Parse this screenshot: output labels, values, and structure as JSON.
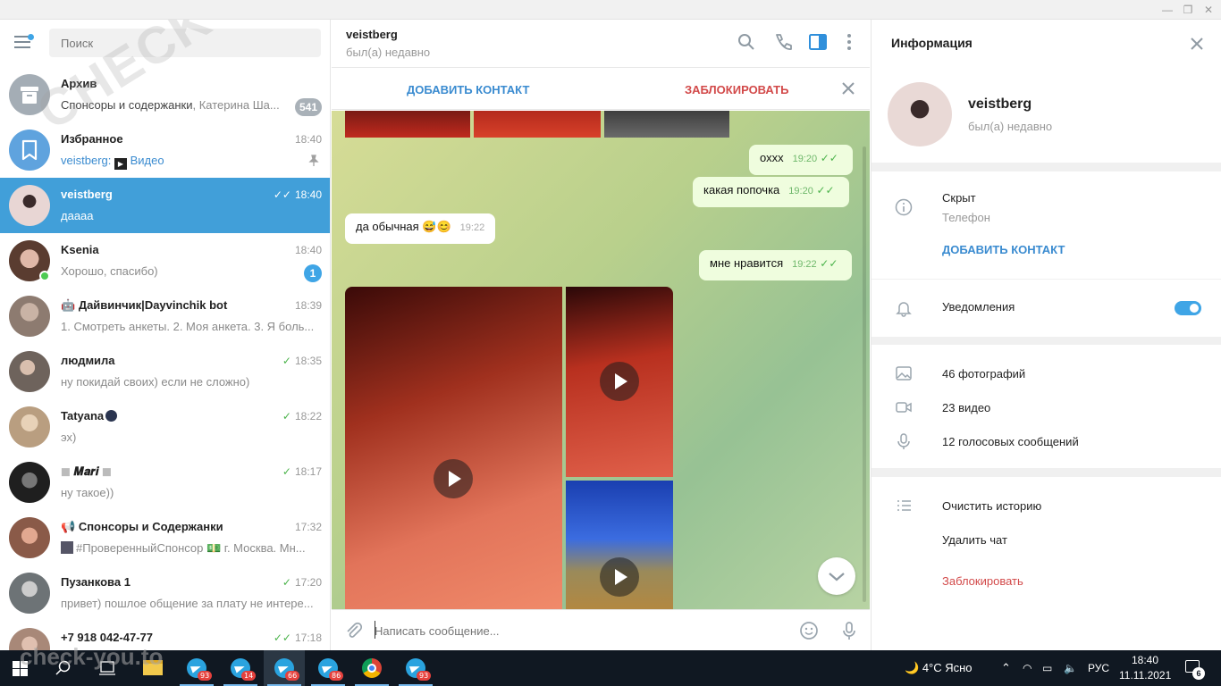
{
  "window": {
    "minimize": "—",
    "maximize": "❐",
    "close": "✕"
  },
  "sidebar": {
    "search_placeholder": "Поиск",
    "chats": [
      {
        "name": "Архив",
        "message": "Спонсоры и содержанки",
        "message_suffix": ", Катерина Ша...",
        "time": "",
        "badge": "541",
        "avatar_color": "#a4adb5"
      },
      {
        "name": "Избранное",
        "message": "veistberg:",
        "message_suffix": "Видео",
        "time": "18:40",
        "badge": "",
        "avatar_color": "#5fa3de"
      },
      {
        "name": "veistberg",
        "message": "даааа",
        "message_suffix": "",
        "time": "18:40",
        "badge": "",
        "avatar_color": "#d8b9b5"
      },
      {
        "name": "Ksenia",
        "message": "Хорошо, спасибо)",
        "message_suffix": "",
        "time": "18:40",
        "badge": "1",
        "avatar_color": "#6b4b3c"
      },
      {
        "name": "Дайвинчик|Dayvinchik bot",
        "message": "1. Смотреть анкеты. 2. Моя анкета. 3. Я боль...",
        "message_suffix": "",
        "time": "18:39",
        "badge": "",
        "avatar_color": "#9a8a80"
      },
      {
        "name": "людмила",
        "message": "ну покидай своих) если не сложно)",
        "message_suffix": "",
        "time": "18:35",
        "badge": "",
        "avatar_color": "#7d6f68"
      },
      {
        "name": "Tatyana",
        "message": "эх)",
        "message_suffix": "",
        "time": "18:22",
        "badge": "",
        "avatar_color": "#c9b59a"
      },
      {
        "name": "𝑴𝒂𝒓𝒊",
        "message": "ну такое))",
        "message_suffix": "",
        "time": "18:17",
        "badge": "",
        "avatar_color": "#3c3c3c"
      },
      {
        "name": "Спонсоры и Содержанки",
        "message": "#ПроверенныйСпонсор 💵 г. Москва. Мн...",
        "message_suffix": "",
        "time": "17:32",
        "badge": "",
        "avatar_color": "#b0806a"
      },
      {
        "name": "Пузанкова 1",
        "message": "привет) пошлое общение за плату не интере...",
        "message_suffix": "",
        "time": "17:20",
        "badge": "",
        "avatar_color": "#8b9091"
      },
      {
        "name": "+7 918 042-47-77",
        "message": "",
        "message_suffix": "",
        "time": "17:18",
        "badge": "",
        "avatar_color": "#b39889"
      }
    ]
  },
  "chat": {
    "peer_name": "veistberg",
    "peer_status": "был(а) недавно",
    "add_contact": "ДОБАВИТЬ КОНТАКТ",
    "block": "ЗАБЛОКИРОВАТЬ",
    "messages": [
      {
        "text": "охxх",
        "time": "19:20",
        "out": true
      },
      {
        "text": "какая попочка",
        "time": "19:20",
        "out": true
      },
      {
        "text": "да обычная 😅😊",
        "time": "19:22",
        "out": false
      },
      {
        "text": "мне нравится",
        "time": "19:22",
        "out": true
      }
    ],
    "input_placeholder": "Написать сообщение..."
  },
  "info": {
    "title": "Информация",
    "name": "veistberg",
    "status": "был(а) недавно",
    "phone_value": "Скрыт",
    "phone_label": "Телефон",
    "add_contact": "ДОБАВИТЬ КОНТАКТ",
    "notifications": "Уведомления",
    "notifications_on": true,
    "photos": "46 фотографий",
    "videos": "23 видео",
    "voice": "12 голосовых сообщений",
    "clear_history": "Очистить историю",
    "delete_chat": "Удалить чат",
    "block": "Заблокировать"
  },
  "taskbar": {
    "badges": [
      "93",
      "14",
      "66",
      "86",
      "93"
    ],
    "weather": "4°C Ясно",
    "language": "РУС",
    "time": "18:40",
    "date": "11.11.2021",
    "notifications": "6"
  },
  "watermark": {
    "top": "CHECK-YOU.ME",
    "bottom": "check-you.to"
  },
  "colors": {
    "accent": "#419fd9",
    "danger": "#d24949",
    "online": "#4dca53"
  }
}
